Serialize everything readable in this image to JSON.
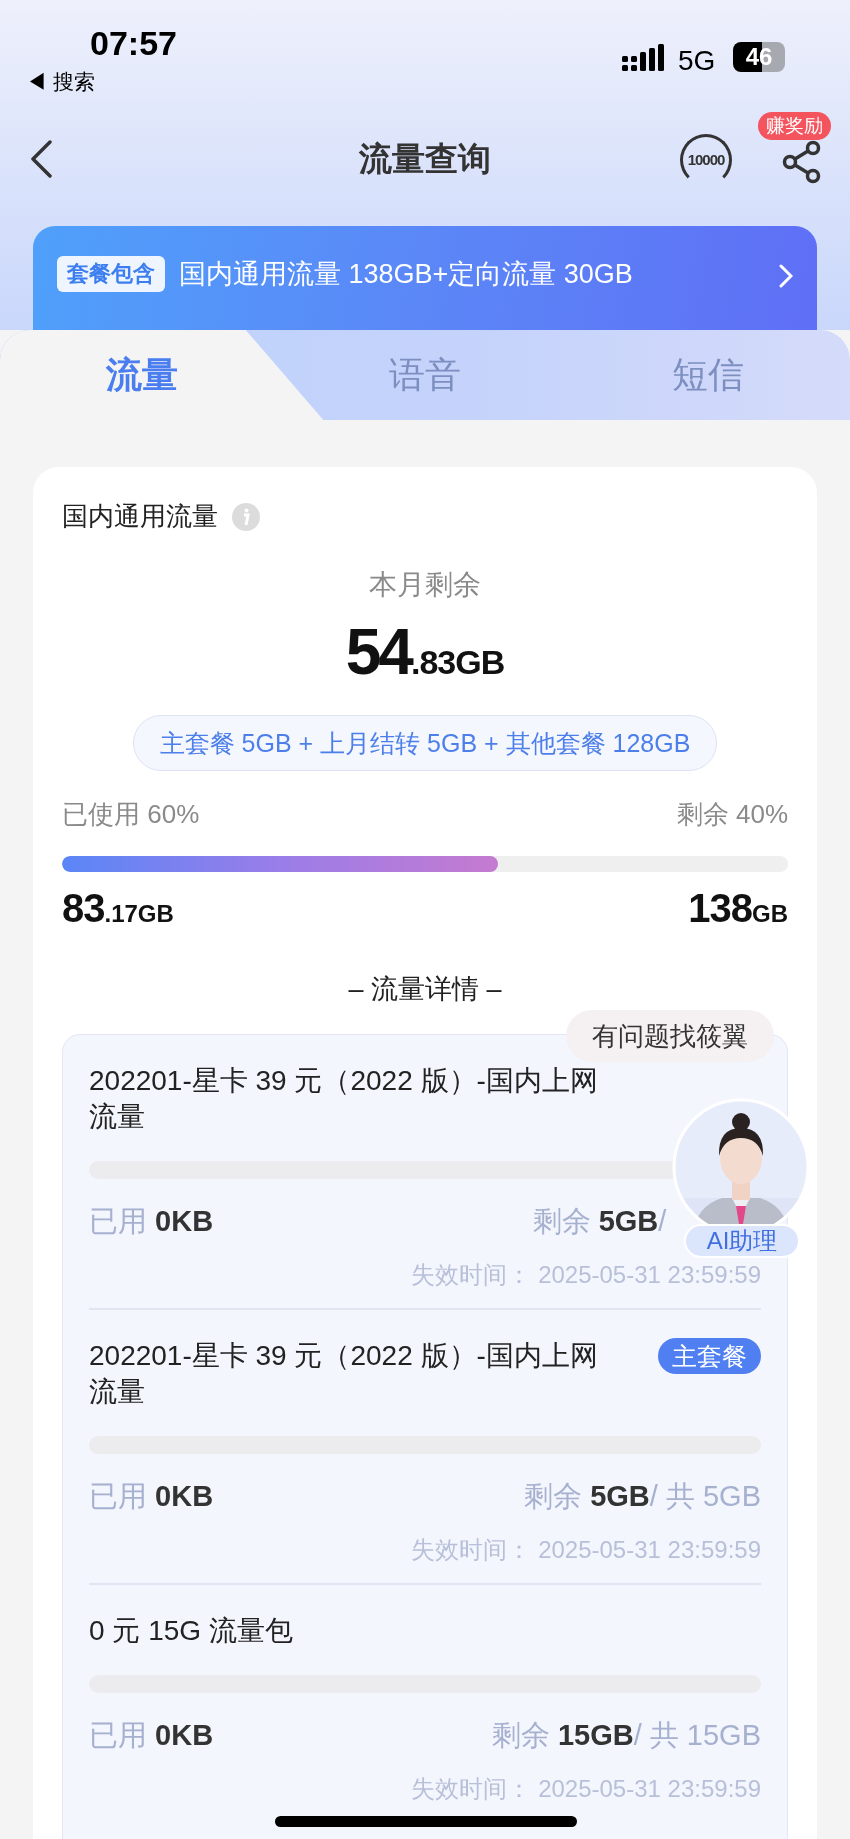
{
  "status_bar": {
    "time": "07:57",
    "back_label": "◀ 搜索",
    "network": "5G",
    "battery": "46"
  },
  "nav": {
    "title": "流量查询",
    "hotline": "10000",
    "reward_badge": "赚奖励"
  },
  "plan_banner": {
    "tag": "套餐包含",
    "text": "国内通用流量 138GB+定向流量 30GB"
  },
  "tabs": [
    {
      "label": "流量",
      "selected": true
    },
    {
      "label": "语音",
      "selected": false
    },
    {
      "label": "短信",
      "selected": false
    }
  ],
  "summary": {
    "title": "国内通用流量",
    "remaining_label": "本月剩余",
    "remaining_main": "54",
    "remaining_rest": ".83GB",
    "breakdown": "主套餐 5GB + 上月结转 5GB + 其他套餐 128GB",
    "used_percent": "已使用 60%",
    "left_percent": "剩余 40%",
    "level": 0.6,
    "used_main": "83",
    "used_rest": ".17GB",
    "total_main": "138",
    "total_rest": "GB",
    "details_heading": "– 流量详情 –"
  },
  "details": [
    {
      "title": "202201-星卡 39 元（2022 版）-国内上网流量",
      "used_label": "已用",
      "used": "0KB",
      "remaining_label": "剩余",
      "remaining": "5GB",
      "total": "/",
      "level": 0,
      "expiry": "失效时间：  2025-05-31 23:59:59"
    },
    {
      "title": "202201-星卡 39 元（2022 版）-国内上网流量",
      "badge": "主套餐",
      "used_label": "已用",
      "used": "0KB",
      "remaining_label": "剩余",
      "remaining": "5GB",
      "total": "/ 共 5GB",
      "level": 0,
      "expiry": "失效时间：  2025-05-31 23:59:59"
    },
    {
      "title": "0 元 15G 流量包",
      "used_label": "已用",
      "used": "0KB",
      "remaining_label": "剩余",
      "remaining": "15GB",
      "total": "/ 共 15GB",
      "level": 0,
      "expiry": "失效时间：  2025-05-31 23:59:59"
    }
  ],
  "assistant": {
    "bubble": "有问题找筱翼",
    "label": "AI助理"
  }
}
